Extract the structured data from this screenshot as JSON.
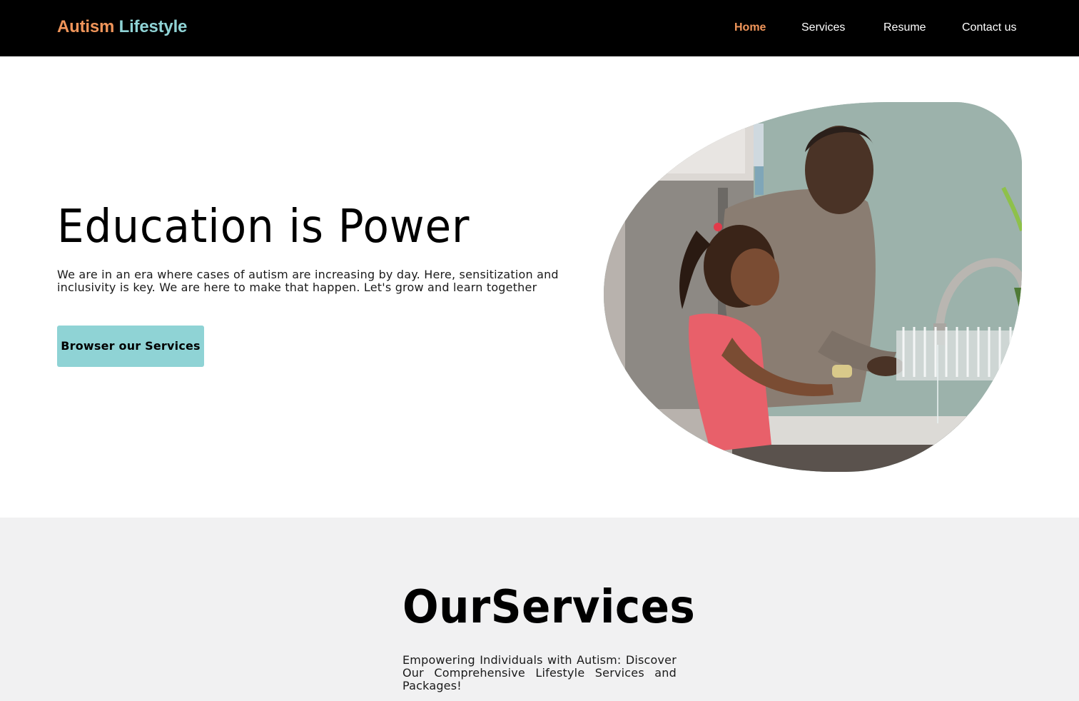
{
  "navbar": {
    "brand_word1": "Autism",
    "brand_word2": "Lifestyle",
    "links": [
      {
        "label": "Home",
        "active": true
      },
      {
        "label": "Services",
        "active": false
      },
      {
        "label": "Resume",
        "active": false
      },
      {
        "label": "Contact us",
        "active": false
      }
    ]
  },
  "hero": {
    "title": "Education is Power",
    "description": "We are in an era where cases of autism are increasing by day. Here, sensitization and inclusivity is key. We are here to make that happen. Let's grow and learn together",
    "button_label": "Browser our Services"
  },
  "services": {
    "title": "OurServices",
    "description": "Empowering Individuals with Autism: Discover Our Comprehensive Lifestyle Services and Packages!"
  },
  "colors": {
    "navbar_bg": "#000000",
    "accent_orange": "#f0955a",
    "accent_teal": "#8fd3d5",
    "section_gray": "#f1f1f2"
  }
}
